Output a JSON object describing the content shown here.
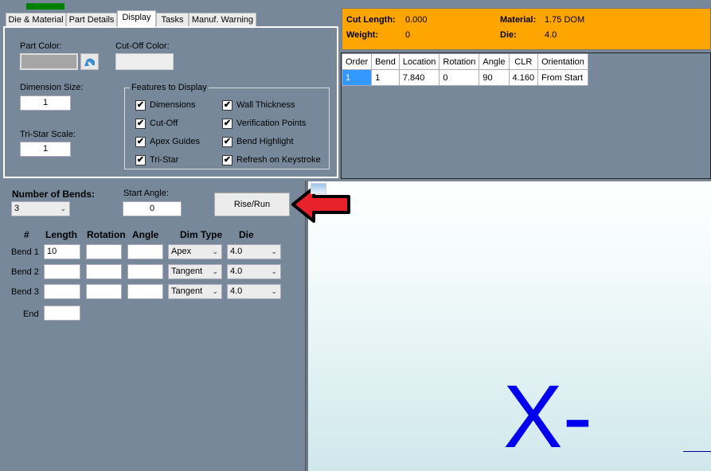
{
  "tabs": [
    "Die & Material",
    "Part Details",
    "Display",
    "Tasks",
    "Manuf. Warning"
  ],
  "display": {
    "part_color_label": "Part Color:",
    "cutoff_color_label": "Cut-Off Color:",
    "dimension_size_label": "Dimension Size:",
    "dimension_size": "1",
    "tristar_scale_label": "Tri-Star Scale:",
    "tristar_scale": "1",
    "features_legend": "Features to Display",
    "features": [
      {
        "label": "Dimensions",
        "checked": true
      },
      {
        "label": "Cut-Off",
        "checked": true
      },
      {
        "label": "Apex Guides",
        "checked": true
      },
      {
        "label": "Tri-Star",
        "checked": true
      },
      {
        "label": "Wall Thickness",
        "checked": true
      },
      {
        "label": "Verification Points",
        "checked": true
      },
      {
        "label": "Bend Highlight",
        "checked": true
      },
      {
        "label": "Refresh on Keystroke",
        "checked": true
      }
    ],
    "check_glyph": "✔"
  },
  "info": {
    "cut_length_label": "Cut Length:",
    "cut_length": "0.000",
    "weight_label": "Weight:",
    "weight": "0",
    "material_label": "Material:",
    "material": "1.75 DOM",
    "die_label": "Die:",
    "die": "4.0",
    "color": "#FFA500"
  },
  "bend_table": {
    "headers": [
      "Order",
      "Bend",
      "Location",
      "Rotation",
      "Angle",
      "CLR",
      "Orientation"
    ],
    "rows": [
      [
        "1",
        "1",
        "7.840",
        "0",
        "90",
        "4.160",
        "From Start"
      ]
    ]
  },
  "bends": {
    "number_label": "Number of Bends:",
    "number": "3",
    "start_angle_label": "Start Angle:",
    "start_angle": "0",
    "rise_run": "Rise/Run",
    "headers": [
      "#",
      "Length",
      "Rotation",
      "Angle",
      "Dim Type",
      "Die"
    ],
    "rows": [
      {
        "label": "Bend 1",
        "length": "10",
        "rotation": "",
        "angle": "",
        "dim_type": "Apex",
        "die": "4.0"
      },
      {
        "label": "Bend 2",
        "length": "",
        "rotation": "",
        "angle": "",
        "dim_type": "Tangent",
        "die": "4.0"
      },
      {
        "label": "Bend 3",
        "length": "",
        "rotation": "",
        "angle": "",
        "dim_type": "Tangent",
        "die": "4.0"
      }
    ],
    "end_label": "End",
    "end": ""
  },
  "chevron": "⌄",
  "canvas": {
    "axis_label": "X-"
  }
}
